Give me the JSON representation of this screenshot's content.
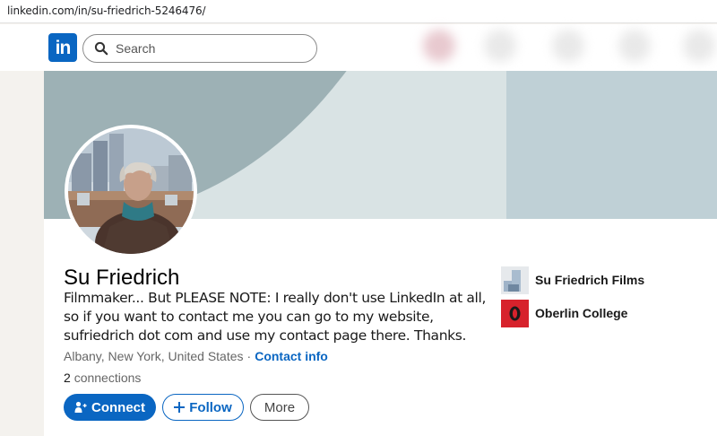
{
  "browser": {
    "url": "linkedin.com/in/su-friedrich-5246476/"
  },
  "nav": {
    "logo_text": "in",
    "search_placeholder": "Search"
  },
  "profile": {
    "name": "Su Friedrich",
    "headline": "Filmmaker... But PLEASE NOTE: I really don't use LinkedIn at all, so if you want to contact me you can go to my website, sufriedrich dot com and use my contact page there. Thanks.",
    "location": "Albany, New York, United States",
    "separator": "·",
    "contact_info_label": "Contact info",
    "connections_count": "2",
    "connections_label": "connections"
  },
  "actions": {
    "connect_label": "Connect",
    "follow_label": "Follow",
    "more_label": "More"
  },
  "organizations": [
    {
      "name": "Su Friedrich Films",
      "icon": "company-logo-icon"
    },
    {
      "name": "Oberlin College",
      "icon": "oberlin-logo-icon"
    }
  ],
  "colors": {
    "brand": "#0a66c2",
    "oberlin_red": "#d7222c"
  }
}
